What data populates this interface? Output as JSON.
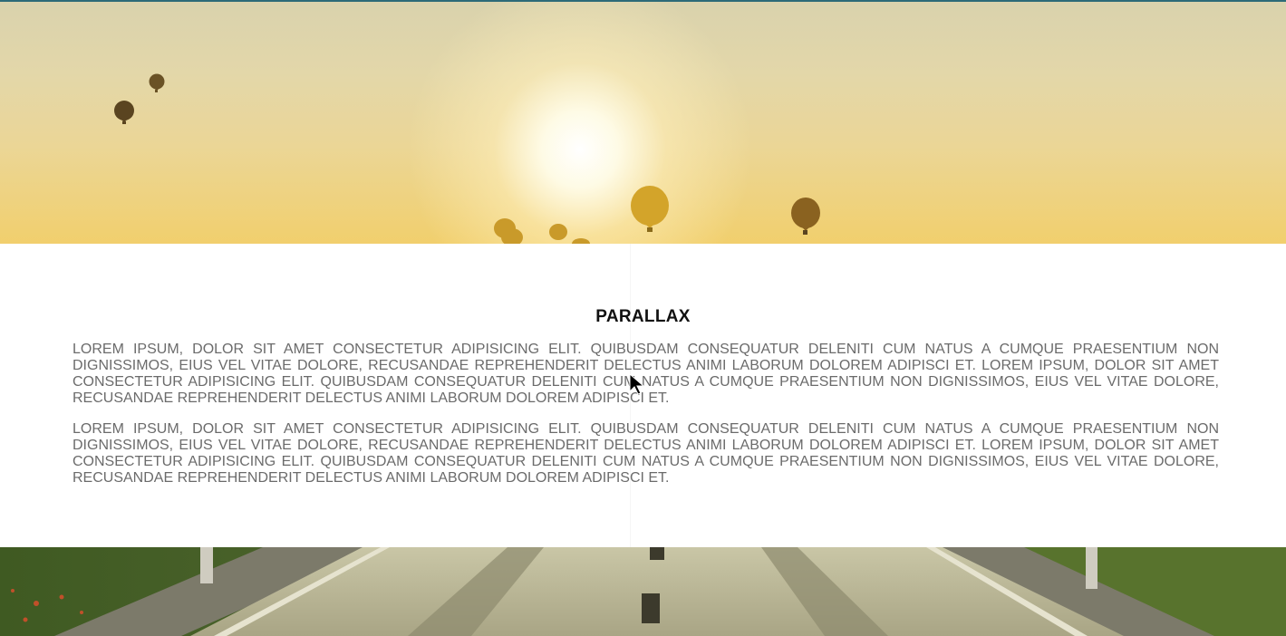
{
  "hero": {
    "image": "sunrise-hot-air-balloons",
    "colors": {
      "sky_top": "#d9d2ad",
      "sky_bottom": "#f1cf6d",
      "balloon_dark": "#5a4420",
      "balloon_gold": "#d9a830"
    }
  },
  "section": {
    "title": "PARALLAX",
    "paragraphs": [
      "Lorem ipsum, dolor sit amet consectetur adipisicing elit. Quibusdam consequatur deleniti cum natus a cumque praesentium non dignissimos, eius vel vitae dolore, recusandae reprehenderit delectus animi laborum dolorem adipisci et. Lorem ipsum, dolor sit amet consectetur adipisicing elit. Quibusdam consequatur deleniti cum natus a cumque praesentium non dignissimos, eius vel vitae dolore, recusandae reprehenderit delectus animi laborum dolorem adipisci et.",
      "Lorem ipsum, dolor sit amet consectetur adipisicing elit. Quibusdam consequatur deleniti cum natus a cumque praesentium non dignissimos, eius vel vitae dolore, recusandae reprehenderit delectus animi laborum dolorem adipisci et. Lorem ipsum, dolor sit amet consectetur adipisicing elit. Quibusdam consequatur deleniti cum natus a cumque praesentium non dignissimos, eius vel vitae dolore, recusandae reprehenderit delectus animi laborum dolorem adipisci et."
    ],
    "text_color": "#6b6b6b",
    "title_color": "#111111"
  },
  "footer_image": {
    "image": "asphalt-road-with-grass",
    "colors": {
      "asphalt": "#b8b594",
      "grass": "#4f6a2a"
    }
  },
  "cursor": {
    "icon": "arrow-cursor-icon"
  },
  "accent": "#2c6a78"
}
